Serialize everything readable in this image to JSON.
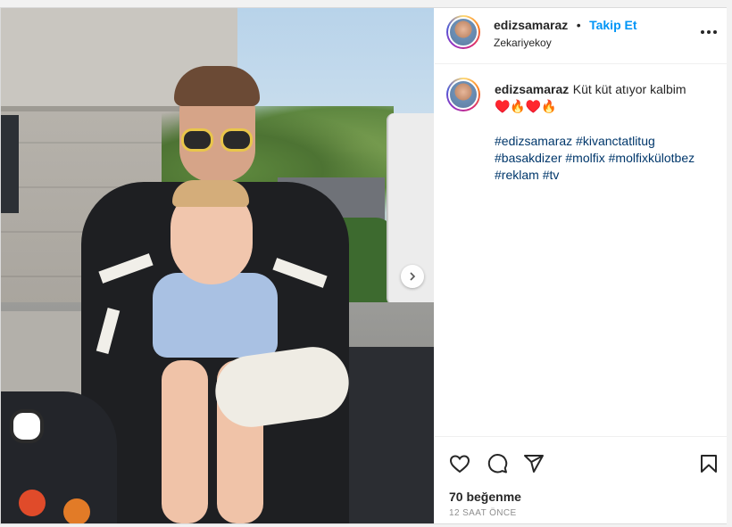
{
  "post": {
    "username": "edizsamaraz",
    "separator": "•",
    "follow_label": "Takip Et",
    "location": "Zekariyekoy",
    "caption_username": "edizsamaraz",
    "caption_text": "Küt küt atıyor kalbim",
    "caption_emoji": "♥️🔥♥️🔥",
    "hashtags": [
      "#edizsamaraz",
      "#kivanctatlitug",
      "#basakdizer",
      "#molfix",
      "#molfixkülotbez",
      "#reklam",
      "#tv"
    ],
    "likes": "70 beğenme",
    "time_ago": "12 SAAT ÖNCE"
  },
  "icons": {
    "more": "more-horizontal-icon",
    "like": "heart-icon",
    "comment": "comment-icon",
    "share": "send-icon",
    "save": "bookmark-icon",
    "next": "chevron-right-icon"
  },
  "colors": {
    "follow": "#0095f6",
    "hashtag": "#00376b",
    "text": "#262626",
    "muted": "#8e8e8e"
  }
}
